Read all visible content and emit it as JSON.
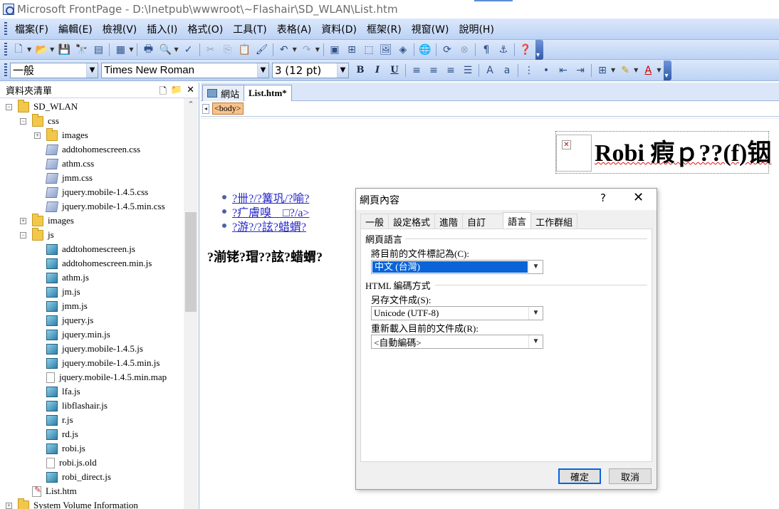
{
  "window": {
    "title": "Microsoft FrontPage - D:\\Inetpub\\wwwroot\\~Flashair\\SD_WLAN\\List.htm"
  },
  "menu": {
    "items": [
      "檔案(F)",
      "編輯(E)",
      "檢視(V)",
      "插入(I)",
      "格式(O)",
      "工具(T)",
      "表格(A)",
      "資料(D)",
      "框架(R)",
      "視窗(W)",
      "說明(H)"
    ]
  },
  "toolbar_format": {
    "style_value": "一般",
    "font_value": "Times New Roman",
    "size_value": "3  (12 pt)",
    "bold": "B",
    "italic": "I",
    "underline": "U"
  },
  "folder_list": {
    "header": "資料夾清單",
    "items": [
      {
        "label": "SD_WLAN",
        "type": "folder",
        "depth": 0,
        "expander": "−"
      },
      {
        "label": "css",
        "type": "folder",
        "depth": 1,
        "expander": "−"
      },
      {
        "label": "images",
        "type": "folder",
        "depth": 2,
        "expander": "+"
      },
      {
        "label": "addtohomescreen.css",
        "type": "css",
        "depth": 2,
        "expander": ""
      },
      {
        "label": "athm.css",
        "type": "css",
        "depth": 2,
        "expander": ""
      },
      {
        "label": "jmm.css",
        "type": "css",
        "depth": 2,
        "expander": ""
      },
      {
        "label": "jquery.mobile-1.4.5.css",
        "type": "css",
        "depth": 2,
        "expander": ""
      },
      {
        "label": "jquery.mobile-1.4.5.min.css",
        "type": "css",
        "depth": 2,
        "expander": ""
      },
      {
        "label": "images",
        "type": "folder",
        "depth": 1,
        "expander": "+"
      },
      {
        "label": "js",
        "type": "folder",
        "depth": 1,
        "expander": "−"
      },
      {
        "label": "addtohomescreen.js",
        "type": "js",
        "depth": 2,
        "expander": ""
      },
      {
        "label": "addtohomescreen.min.js",
        "type": "js",
        "depth": 2,
        "expander": ""
      },
      {
        "label": "athm.js",
        "type": "js",
        "depth": 2,
        "expander": ""
      },
      {
        "label": "jm.js",
        "type": "js",
        "depth": 2,
        "expander": ""
      },
      {
        "label": "jmm.js",
        "type": "js",
        "depth": 2,
        "expander": ""
      },
      {
        "label": "jquery.js",
        "type": "js",
        "depth": 2,
        "expander": ""
      },
      {
        "label": "jquery.min.js",
        "type": "js",
        "depth": 2,
        "expander": ""
      },
      {
        "label": "jquery.mobile-1.4.5.js",
        "type": "js",
        "depth": 2,
        "expander": ""
      },
      {
        "label": "jquery.mobile-1.4.5.min.js",
        "type": "js",
        "depth": 2,
        "expander": ""
      },
      {
        "label": "jquery.mobile-1.4.5.min.map",
        "type": "file",
        "depth": 2,
        "expander": ""
      },
      {
        "label": "lfa.js",
        "type": "js",
        "depth": 2,
        "expander": ""
      },
      {
        "label": "libflashair.js",
        "type": "js",
        "depth": 2,
        "expander": ""
      },
      {
        "label": "r.js",
        "type": "js",
        "depth": 2,
        "expander": ""
      },
      {
        "label": "rd.js",
        "type": "js",
        "depth": 2,
        "expander": ""
      },
      {
        "label": "robi.js",
        "type": "js",
        "depth": 2,
        "expander": ""
      },
      {
        "label": "robi.js.old",
        "type": "file",
        "depth": 2,
        "expander": ""
      },
      {
        "label": "robi_direct.js",
        "type": "js",
        "depth": 2,
        "expander": ""
      },
      {
        "label": "List.htm",
        "type": "htm",
        "depth": 1,
        "expander": ""
      },
      {
        "label": "System Volume Information",
        "type": "folder",
        "depth": 0,
        "expander": "+"
      }
    ]
  },
  "editor": {
    "tabs": [
      "網站",
      "List.htm*"
    ],
    "quick_tag": "<body>",
    "heading": "Robi 瘕ｐ??(f)铟",
    "links": [
      "?卌?/?篝巩/?喻?",
      "?疒膚嗅　□?/a>",
      "?游?/?詃?蜡蝟?"
    ],
    "body_text": "?湔铑?瑁??詃?蜡蝟?"
  },
  "dialog": {
    "title": "網頁內容",
    "help": "?",
    "close": "✕",
    "tabs": [
      "一般",
      "設定格式",
      "進階",
      "自訂",
      "語言",
      "工作群組"
    ],
    "active_tab": "語言",
    "page_language_group": "網頁語言",
    "mark_label": "將目前的文件標記為(C):",
    "mark_value": "中文 (台灣)",
    "encoding_group": "HTML 編碼方式",
    "save_label": "另存文件成(S):",
    "save_value": "Unicode (UTF-8)",
    "reload_label": "重新載入目前的文件成(R):",
    "reload_value": "<自動編碼>",
    "ok": "確定",
    "cancel": "取消"
  }
}
